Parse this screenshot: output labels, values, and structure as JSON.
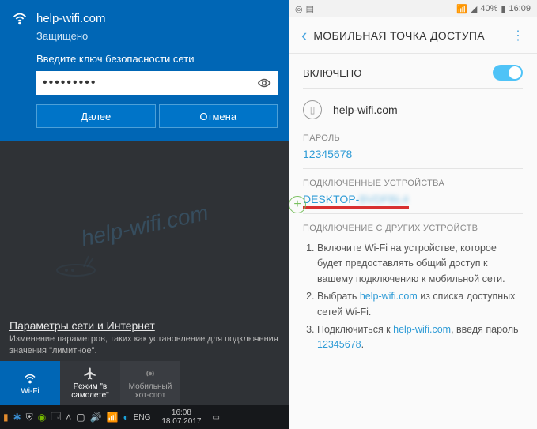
{
  "windows": {
    "wifi_name": "help-wifi.com",
    "status": "Защищено",
    "prompt": "Введите ключ безопасности сети",
    "password_mask": "•••••••••",
    "btn_next": "Далее",
    "btn_cancel": "Отмена",
    "watermark": "help-wifi.com",
    "settings_link": "Параметры сети и Интернет",
    "settings_desc": "Изменение параметров, таких как установление для подключения значения \"лимитное\".",
    "tiles": {
      "wifi": "Wi-Fi",
      "airplane": "Режим \"в самолете\"",
      "hotspot": "Мобильный хот-спот"
    },
    "taskbar": {
      "lang": "ENG",
      "time": "16:08",
      "date": "18.07.2017"
    }
  },
  "android": {
    "status": {
      "signal": "40%",
      "time": "16:09"
    },
    "title": "МОБИЛЬНАЯ ТОЧКА ДОСТУПА",
    "enabled_label": "ВКЛЮЧЕНО",
    "ssid": "help-wifi.com",
    "password_label": "ПАРОЛЬ",
    "password": "12345678",
    "devices_label": "ПОДКЛЮЧЕННЫЕ УСТРОЙСТВА",
    "device_prefix": "DESKTOP-",
    "device_blur": "BVDFBL4",
    "other_label": "ПОДКЛЮЧЕНИЕ С ДРУГИХ УСТРОЙСТВ",
    "instr": {
      "i1a": "Включите Wi-Fi на устройстве, которое будет предоставлять общий доступ к вашему подключению к мобильной сети.",
      "i2a": "Выбрать ",
      "i2b": "help-wifi.com",
      "i2c": " из списка доступных сетей Wi-Fi.",
      "i3a": "Подключиться к ",
      "i3b": "help-wifi.com",
      "i3c": ", введя пароль ",
      "i3d": "12345678",
      "i3e": "."
    }
  }
}
